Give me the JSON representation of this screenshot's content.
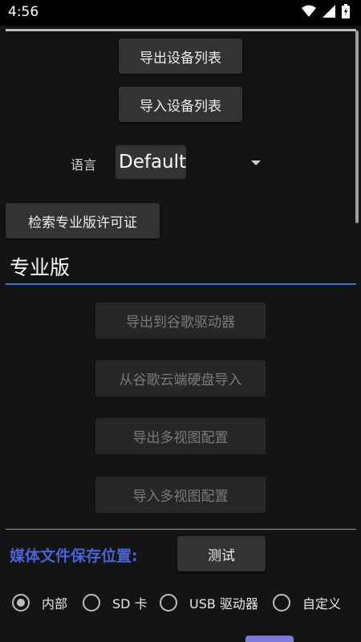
{
  "status_bar": {
    "time": "4:56",
    "icons": [
      "wifi-icon",
      "signal-icon",
      "battery-icon"
    ]
  },
  "buttons": {
    "export_device_list": "导出设备列表",
    "import_device_list": "导入设备列表",
    "search_pro_license": "检索专业版许可证"
  },
  "language": {
    "label": "语言",
    "selected": "Default"
  },
  "pro_section": {
    "title": "专业版",
    "export_to_google_drive": "导出到谷歌驱动器",
    "import_from_google_drive": "从谷歌云端硬盘导入",
    "export_multiview_config": "导出多视图配置",
    "import_multiview_config": "导入多视图配置"
  },
  "media_location": {
    "label": "媒体文件保存位置:",
    "test_button": "测试",
    "options": [
      "内部",
      "SD 卡",
      "USB 驱动器",
      "自定义"
    ],
    "selected_index": 0
  },
  "colors": {
    "accent_underline": "#2d7bd6",
    "media_label": "#4a63d8",
    "background": "#141414"
  }
}
